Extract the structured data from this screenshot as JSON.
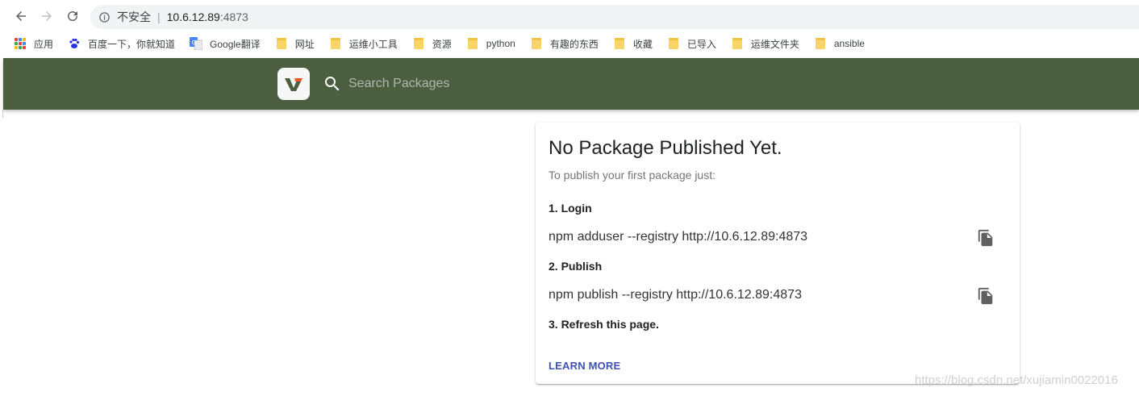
{
  "browser": {
    "security_label": "不安全",
    "url_host": "10.6.12.89",
    "url_port": ":4873",
    "bookmarks": [
      {
        "label": "应用",
        "icon": "apps-icon"
      },
      {
        "label": "百度一下，你就知道",
        "icon": "baidu-icon"
      },
      {
        "label": "Google翻译",
        "icon": "google-translate-icon"
      },
      {
        "label": "网址",
        "icon": "folder-icon"
      },
      {
        "label": "运维小工具",
        "icon": "folder-icon"
      },
      {
        "label": "资源",
        "icon": "folder-icon"
      },
      {
        "label": "python",
        "icon": "folder-icon"
      },
      {
        "label": "有趣的东西",
        "icon": "folder-icon"
      },
      {
        "label": "收藏",
        "icon": "folder-icon"
      },
      {
        "label": "已导入",
        "icon": "folder-icon"
      },
      {
        "label": "运维文件夹",
        "icon": "folder-icon"
      },
      {
        "label": "ansible",
        "icon": "folder-icon"
      }
    ]
  },
  "header": {
    "search_placeholder": "Search Packages",
    "background_color": "#4b5e40"
  },
  "card": {
    "title": "No Package Published Yet.",
    "subtitle": "To publish your first package just:",
    "steps": [
      {
        "label": "1. Login",
        "command": "npm adduser --registry http://10.6.12.89:4873"
      },
      {
        "label": "2. Publish",
        "command": "npm publish --registry http://10.6.12.89:4873"
      },
      {
        "label": "3. Refresh this page."
      }
    ],
    "learn_more": "LEARN MORE"
  },
  "watermark": "https://blog.csdn.net/xujiamin0022016"
}
